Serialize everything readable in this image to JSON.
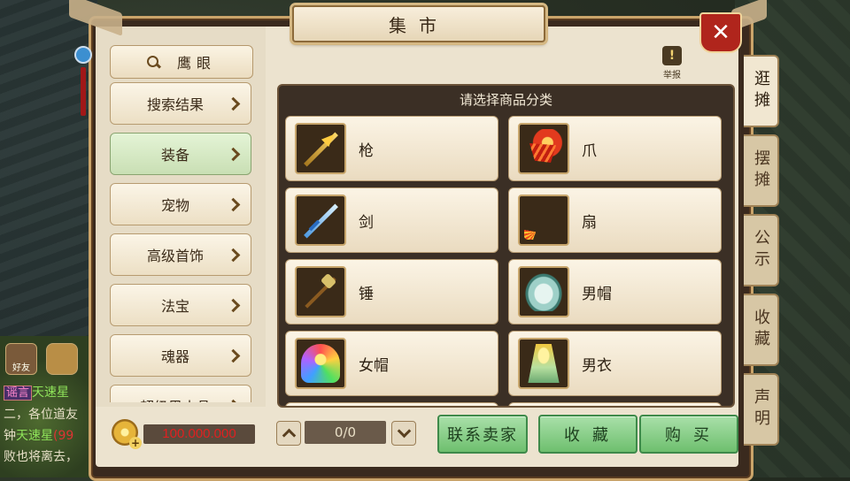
{
  "title": "集市",
  "close_label": "✕",
  "search": {
    "label": "鹰眼"
  },
  "report": {
    "label": "举报"
  },
  "categories": [
    {
      "label": "搜索结果",
      "active": false
    },
    {
      "label": "装备",
      "active": true
    },
    {
      "label": "宠物",
      "active": false
    },
    {
      "label": "高级首饰",
      "active": false
    },
    {
      "label": "法宝",
      "active": false
    },
    {
      "label": "魂器",
      "active": false
    },
    {
      "label": "超级黑水晶",
      "active": false
    }
  ],
  "goods": {
    "header": "请选择商品分类",
    "items": [
      {
        "name": "枪",
        "icon": "spear-icon"
      },
      {
        "name": "爪",
        "icon": "claw-icon"
      },
      {
        "name": "剑",
        "icon": "sword-icon"
      },
      {
        "name": "扇",
        "icon": "fan-icon"
      },
      {
        "name": "锤",
        "icon": "hammer-icon"
      },
      {
        "name": "男帽",
        "icon": "male-hat-icon"
      },
      {
        "name": "女帽",
        "icon": "female-hat-icon"
      },
      {
        "name": "男衣",
        "icon": "male-robe-icon"
      }
    ]
  },
  "side_tabs": [
    {
      "label": "逛摊",
      "active": true
    },
    {
      "label": "摆摊",
      "active": false
    },
    {
      "label": "公示",
      "active": false
    },
    {
      "label": "收藏",
      "active": false
    },
    {
      "label": "声明",
      "active": false
    }
  ],
  "bottom": {
    "money": "100.000.000",
    "page": "0/0",
    "contact_seller": "联系卖家",
    "favorite": "收藏",
    "buy": "购买"
  },
  "chat": {
    "friend_label": "好友",
    "line1_tag": "谣言",
    "line1_name": "天速星",
    "line2": "二，各位道友",
    "line3_prefix": "钟",
    "line3_name": "天速星",
    "line3_suffix": "(99",
    "line4": "败也将离去，"
  }
}
